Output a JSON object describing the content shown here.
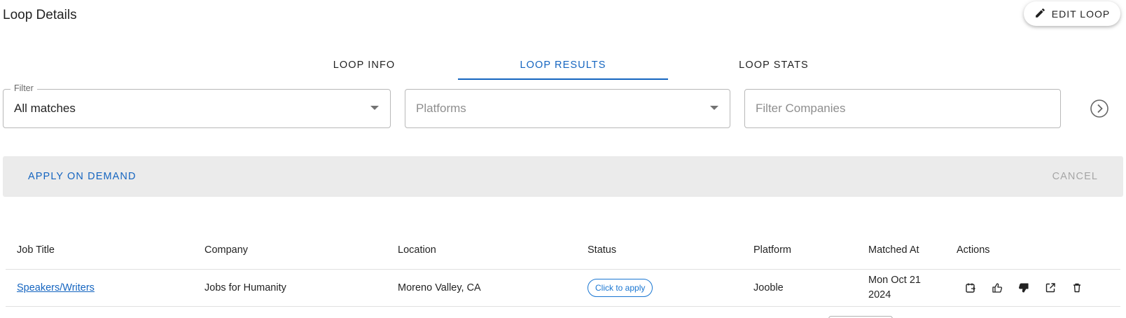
{
  "header": {
    "title": "Loop Details",
    "edit_label": "EDIT LOOP"
  },
  "tabs": [
    {
      "label": "LOOP INFO",
      "active": false
    },
    {
      "label": "LOOP RESULTS",
      "active": true
    },
    {
      "label": "LOOP STATS",
      "active": false
    }
  ],
  "filters": {
    "filter": {
      "legend": "Filter",
      "value": "All matches"
    },
    "platforms": {
      "placeholder": "Platforms"
    },
    "companies": {
      "placeholder": "Filter Companies"
    }
  },
  "action_bar": {
    "apply_label": "APPLY ON DEMAND",
    "cancel_label": "CANCEL"
  },
  "table": {
    "headers": [
      "Job Title",
      "Company",
      "Location",
      "Status",
      "Platform",
      "Matched At",
      "Actions"
    ],
    "rows": [
      {
        "job_title": "Speakers/Writers",
        "company": "Jobs for Humanity",
        "location": "Moreno Valley, CA",
        "status": "Click to apply",
        "platform": "Jooble",
        "matched_at": "Mon Oct 21 2024",
        "actions": [
          "schedule-icon",
          "thumb-up-icon",
          "thumb-down-icon",
          "open-external-icon",
          "delete-icon"
        ]
      }
    ]
  },
  "colors": {
    "accent": "#1565c0",
    "action_bar_bg": "#ebebeb"
  }
}
